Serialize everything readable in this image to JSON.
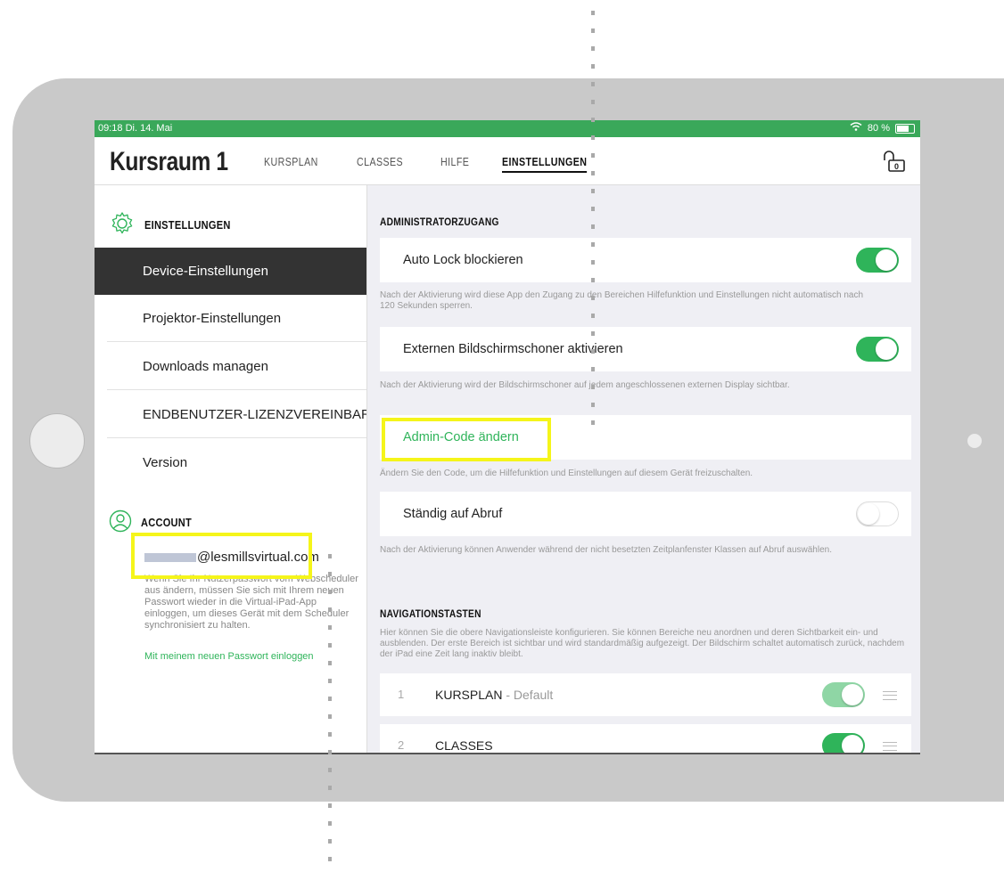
{
  "status_bar": {
    "time": "09:18  Di. 14. Mai",
    "battery": "80 %"
  },
  "header": {
    "title": "Kursraum 1",
    "tabs": [
      {
        "label": "KURSPLAN"
      },
      {
        "label": "CLASSES"
      },
      {
        "label": "HILFE"
      },
      {
        "label": "EINSTELLUNGEN"
      }
    ],
    "lock_badge": "0"
  },
  "sidebar": {
    "settings_heading": "EINSTELLUNGEN",
    "items": [
      {
        "label": "Device-Einstellungen"
      },
      {
        "label": "Projektor-Einstellungen"
      },
      {
        "label": "Downloads managen"
      },
      {
        "label": "ENDBENUTZER-LIZENZVEREINBARUNG"
      },
      {
        "label": "Version"
      }
    ],
    "account_heading": "ACCOUNT",
    "email_visible": "@lesmillsvirtual.com",
    "account_note": "Wenn Sie Ihr Nutzerpasswort vom Webscheduler aus ändern, müssen Sie sich mit Ihrem neuen Passwort wieder in die Virtual-iPad-App einloggen, um dieses Gerät mit dem Scheduler synchronisiert zu halten.",
    "relogin_link": "Mit meinem neuen Passwort einloggen"
  },
  "main": {
    "admin_heading": "ADMINISTRATORZUGANG",
    "auto_lock": {
      "label": "Auto Lock blockieren",
      "on": true,
      "note": "Nach der Aktivierung wird diese App den Zugang zu den Bereichen Hilfefunktion und Einstellungen nicht automatisch nach 120 Sekunden sperren."
    },
    "screensaver": {
      "label": "Externen Bildschirmschoner aktivieren",
      "on": true,
      "note": "Nach der Aktivierung wird der Bildschirmschoner auf jedem angeschlossenen externen Display sichtbar."
    },
    "admin_code": {
      "label": "Admin-Code ändern",
      "note": "Ändern Sie den Code, um die Hilfefunktion und Einstellungen auf diesem Gerät freizuschalten."
    },
    "on_demand": {
      "label": "Ständig auf Abruf",
      "on": false,
      "note": "Nach der Aktivierung können Anwender während der nicht besetzten Zeitplanfenster Klassen auf Abruf auswählen."
    },
    "nav_heading": "NAVIGATIONSTASTEN",
    "nav_desc": "Hier können Sie die obere Navigationsleiste konfigurieren. Sie können Bereiche neu anordnen und deren Sichtbarkeit ein- und ausblenden. Der erste Bereich ist sichtbar und wird standardmäßig aufgezeigt. Der Bildschirm schaltet automatisch zurück, nachdem der iPad eine Zeit lang inaktiv bleibt.",
    "nav_items": [
      {
        "num": "1",
        "name": "KURSPLAN",
        "suffix": " - Default"
      },
      {
        "num": "2",
        "name": "CLASSES",
        "suffix": ""
      }
    ]
  },
  "colors": {
    "accent": "#2fb45a",
    "status_bar": "#3aa85a",
    "highlight": "#f5f51a"
  }
}
